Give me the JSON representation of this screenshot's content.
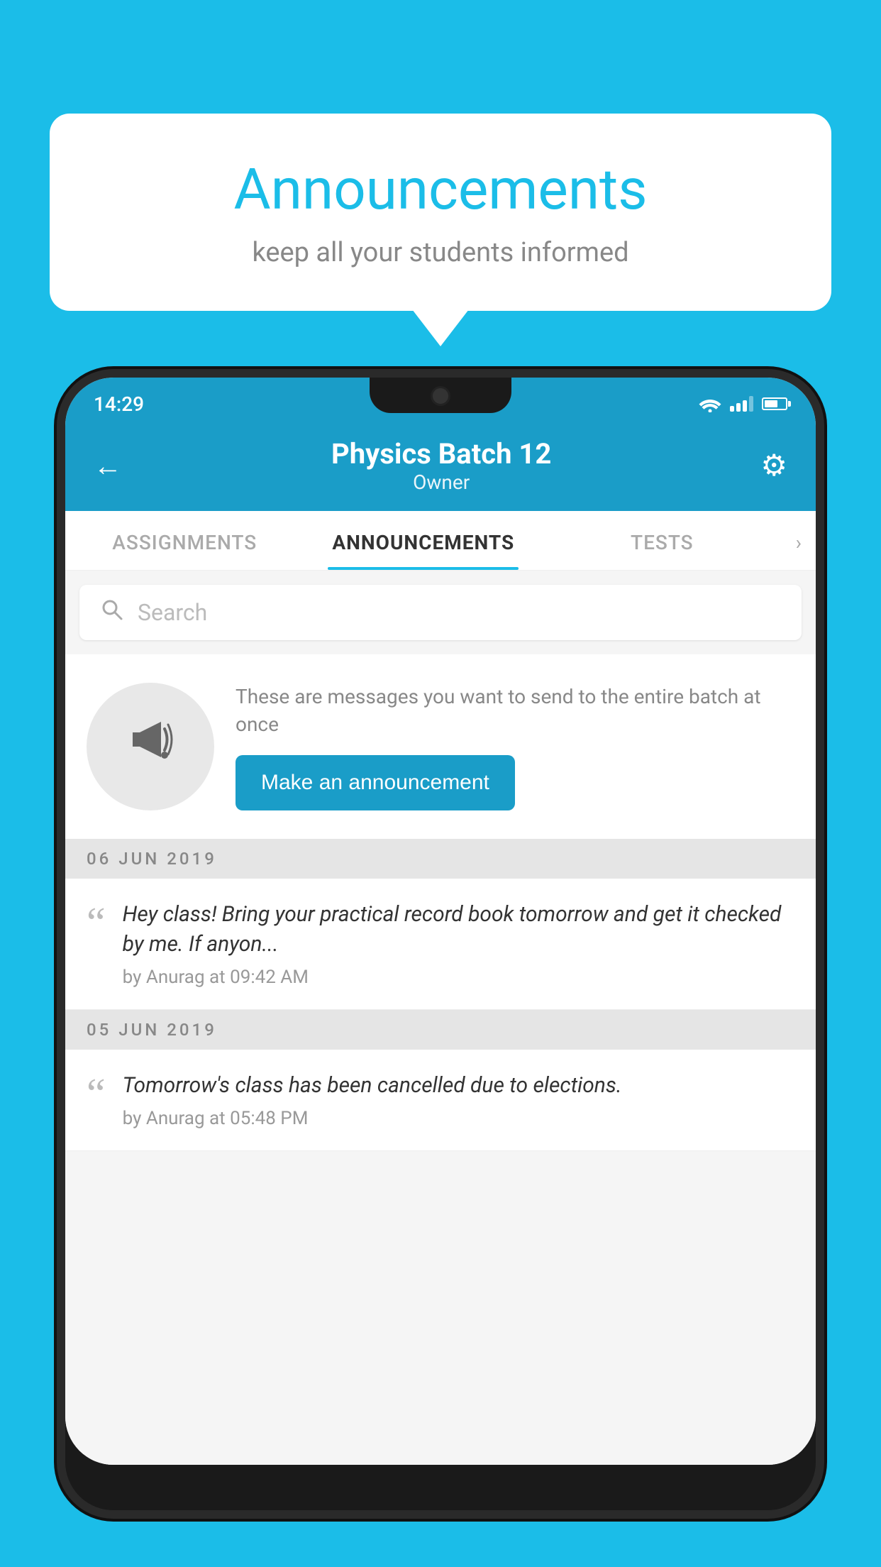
{
  "bubble": {
    "title": "Announcements",
    "subtitle": "keep all your students informed"
  },
  "phone": {
    "status": {
      "time": "14:29"
    },
    "header": {
      "back_label": "←",
      "title": "Physics Batch 12",
      "subtitle": "Owner",
      "settings_label": "⚙"
    },
    "tabs": [
      {
        "label": "ASSIGNMENTS",
        "active": false
      },
      {
        "label": "ANNOUNCEMENTS",
        "active": true
      },
      {
        "label": "TESTS",
        "active": false
      }
    ],
    "search": {
      "placeholder": "Search"
    },
    "prompt": {
      "description": "These are messages you want to send to the entire batch at once",
      "button_label": "Make an announcement"
    },
    "dates": [
      {
        "label": "06  JUN  2019",
        "announcements": [
          {
            "text": "Hey class! Bring your practical record book tomorrow and get it checked by me. If anyon...",
            "by": "by Anurag at 09:42 AM"
          }
        ]
      },
      {
        "label": "05  JUN  2019",
        "announcements": [
          {
            "text": "Tomorrow's class has been cancelled due to elections.",
            "by": "by Anurag at 05:48 PM"
          }
        ]
      }
    ]
  }
}
